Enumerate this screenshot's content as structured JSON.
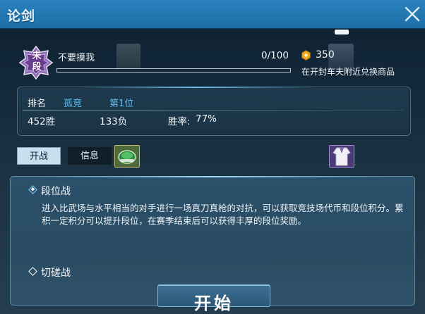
{
  "window": {
    "title": "论剑"
  },
  "player": {
    "name": "不要摸我",
    "rank_badge_text": "未段",
    "progress_text": "0/100",
    "progress_fraction": 0.0
  },
  "currency": {
    "icon": "coin-icon",
    "amount": "350",
    "hint": "在开封车夫附近兑换商品",
    "color": "#f1a51d"
  },
  "stats": {
    "rank_label": "排名",
    "rank_title": "孤竞",
    "rank_position": "第1位",
    "wins": "452胜",
    "losses": "133负",
    "winrate_label": "胜率:",
    "winrate_value": "77%"
  },
  "tabs": [
    {
      "label": "开战",
      "selected": true
    },
    {
      "label": "信息",
      "selected": false
    }
  ],
  "items": [
    {
      "icon": "green-armguard-icon"
    },
    {
      "icon": "white-robe-icon"
    }
  ],
  "modes": [
    {
      "label": "段位战",
      "selected": true,
      "description": "进入比武场与水平相当的对手进行一场真刀真枪的对抗，可以获取竞技场代币和段位积分。累积一定积分可以提升段位，在赛季结束后可以获得丰厚的段位奖励。"
    },
    {
      "label": "切磋战",
      "selected": false
    }
  ],
  "start_button": {
    "label": "开始"
  },
  "colors": {
    "title_bar": "#2a82bd",
    "accent_blue": "#5bbff0",
    "panel": "#2b5069"
  }
}
